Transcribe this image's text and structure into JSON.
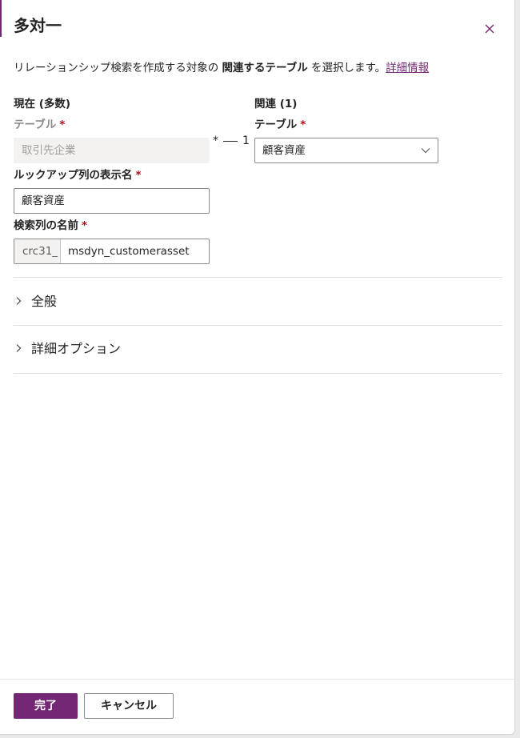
{
  "panel": {
    "title": "多対一",
    "description_prefix": "リレーションシップ検索を作成する対象の ",
    "description_bold": "関連するテーブル",
    "description_suffix": " を選択します。",
    "learn_more": "詳細情報"
  },
  "current": {
    "heading": "現在 (多数)",
    "table_label": "テーブル",
    "table_value": "取引先企業"
  },
  "related": {
    "heading": "関連 (1)",
    "table_label": "テーブル",
    "table_value": "顧客資産"
  },
  "cardinality": {
    "many": "*",
    "one": "1"
  },
  "lookup_display": {
    "label": "ルックアップ列の表示名",
    "value": "顧客資産"
  },
  "lookup_name": {
    "label": "検索列の名前",
    "prefix": "crc31_",
    "value": "msdyn_customerasset"
  },
  "required_mark": "*",
  "sections": [
    "全般",
    "詳細オプション"
  ],
  "footer": {
    "done": "完了",
    "cancel": "キャンセル"
  },
  "colors": {
    "accent": "#742774",
    "required": "#b10e1c"
  },
  "icons": {
    "close": "close-icon",
    "dropdown": "chevron-down-icon",
    "expand": "chevron-right-icon"
  }
}
